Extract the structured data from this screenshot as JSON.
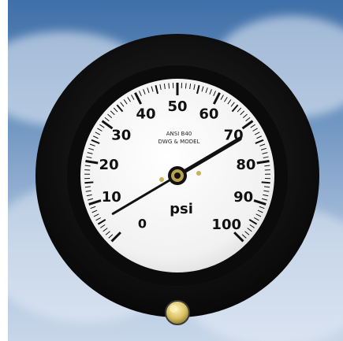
{
  "gauge": {
    "min_label": "0",
    "max_label": "100",
    "unit": "psi",
    "labels": [
      "10",
      "20",
      "30",
      "40",
      "50",
      "60",
      "70",
      "80",
      "90",
      "100"
    ],
    "small_text_line1": "ANSI B40",
    "small_text_line2": "DWG & MODEL",
    "needle_value_psi": 72,
    "colors": {
      "bezel": "#111111",
      "dial": "#f3f3f3",
      "needle": "#111111",
      "accent_screw": "#d9c266"
    }
  }
}
